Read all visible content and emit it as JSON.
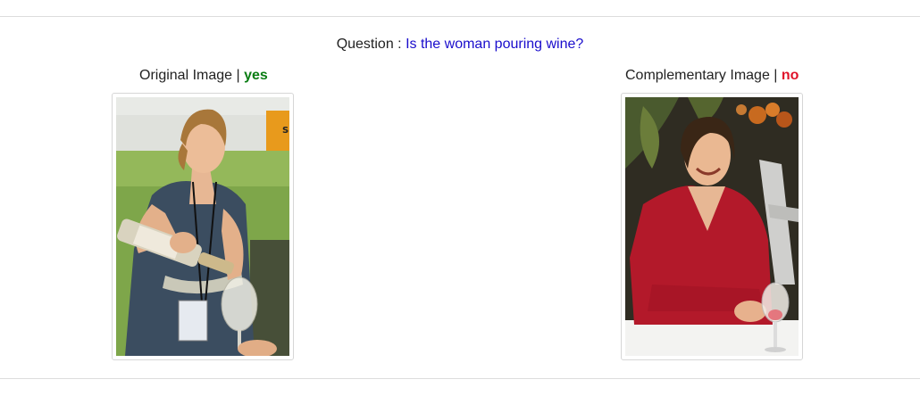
{
  "question": {
    "prefix": "Question : ",
    "text": "Is the woman pouring wine?"
  },
  "original": {
    "label": "Original Image",
    "separator": " | ",
    "answer": "yes",
    "answer_color": "#0a7d13"
  },
  "complementary": {
    "label": "Complementary Image",
    "separator": " | ",
    "answer": "no",
    "answer_color": "#e0142b"
  },
  "colors": {
    "question_text": "#1a0dcc",
    "rule": "#dcdcdc"
  }
}
